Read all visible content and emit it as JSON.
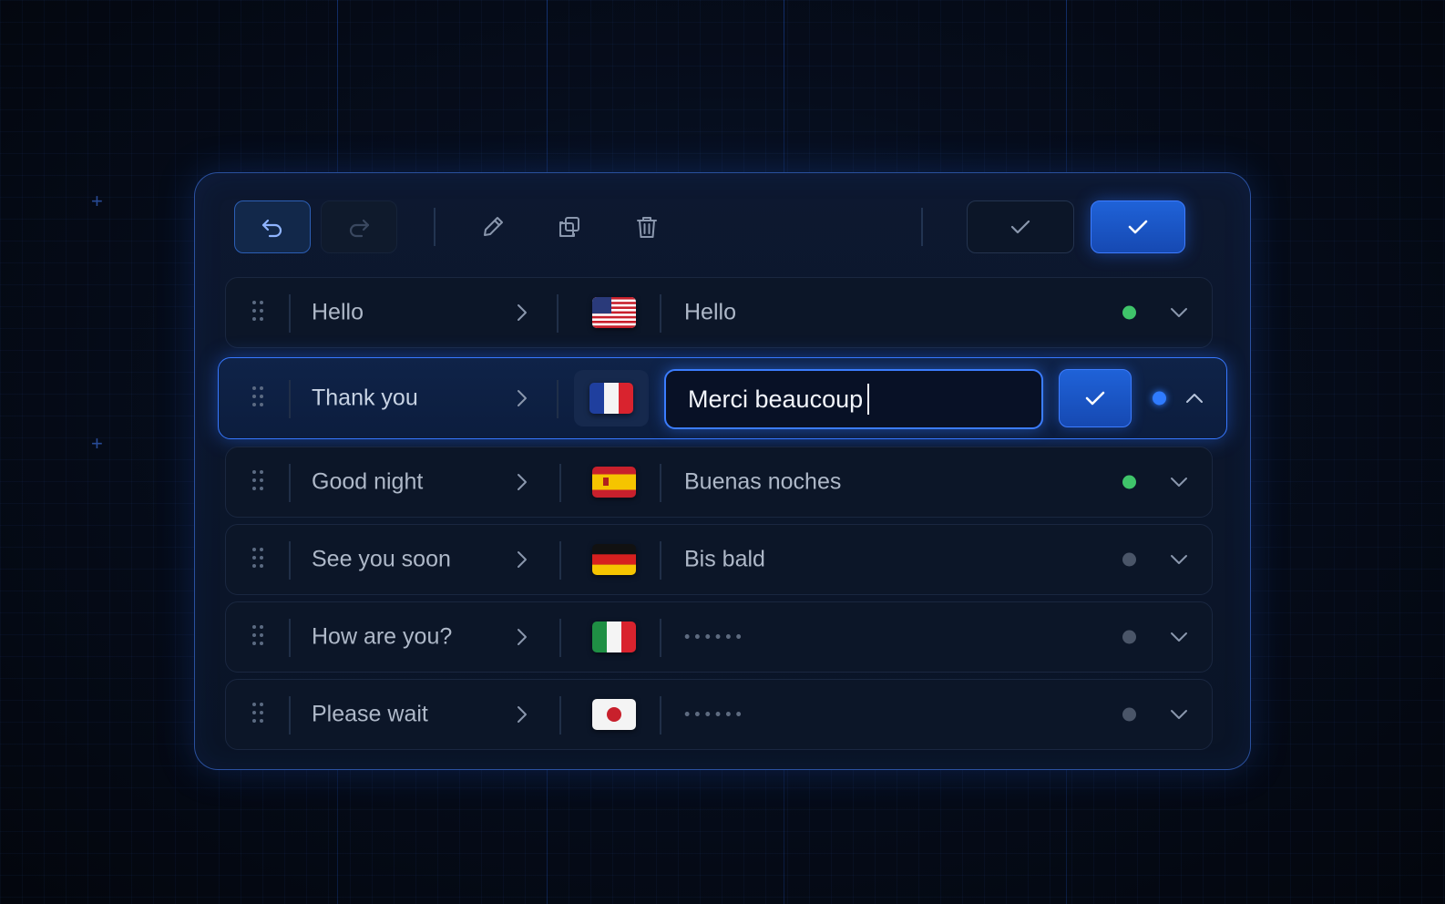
{
  "toolbar": {
    "undo_icon": "undo-icon",
    "redo_icon": "redo-icon",
    "edit_icon": "pencil-icon",
    "duplicate_icon": "duplicate-icon",
    "delete_icon": "trash-icon",
    "approve_icon": "check-icon",
    "confirm_icon": "check-icon"
  },
  "rows": [
    {
      "source": "Hello",
      "flag": "us-flag-icon",
      "target": "Hello",
      "status": "translated",
      "status_color": "#3fc46a"
    },
    {
      "source": "Thank you",
      "flag": "fr-flag-icon",
      "target_value": "Merci beaucoup",
      "status": "editing",
      "status_color": "#2f7bff"
    },
    {
      "source": "Good night",
      "flag": "es-flag-icon",
      "target": "Buenas noches",
      "status": "translated",
      "status_color": "#3fc46a"
    },
    {
      "source": "See you soon",
      "flag": "de-flag-icon",
      "target": "Bis bald",
      "status": "pending",
      "status_color": "#4a5568"
    },
    {
      "source": "How are you?",
      "flag": "it-flag-icon",
      "target": "••••••",
      "status": "pending",
      "status_color": "#4a5568"
    },
    {
      "source": "Please wait",
      "flag": "jp-flag-icon",
      "target": "••••••",
      "status": "pending",
      "status_color": "#4a5568"
    }
  ],
  "colors": {
    "accent": "#2f6fe8",
    "success": "#3fc46a",
    "neutral": "#4a5568",
    "background": "#060d1c"
  }
}
